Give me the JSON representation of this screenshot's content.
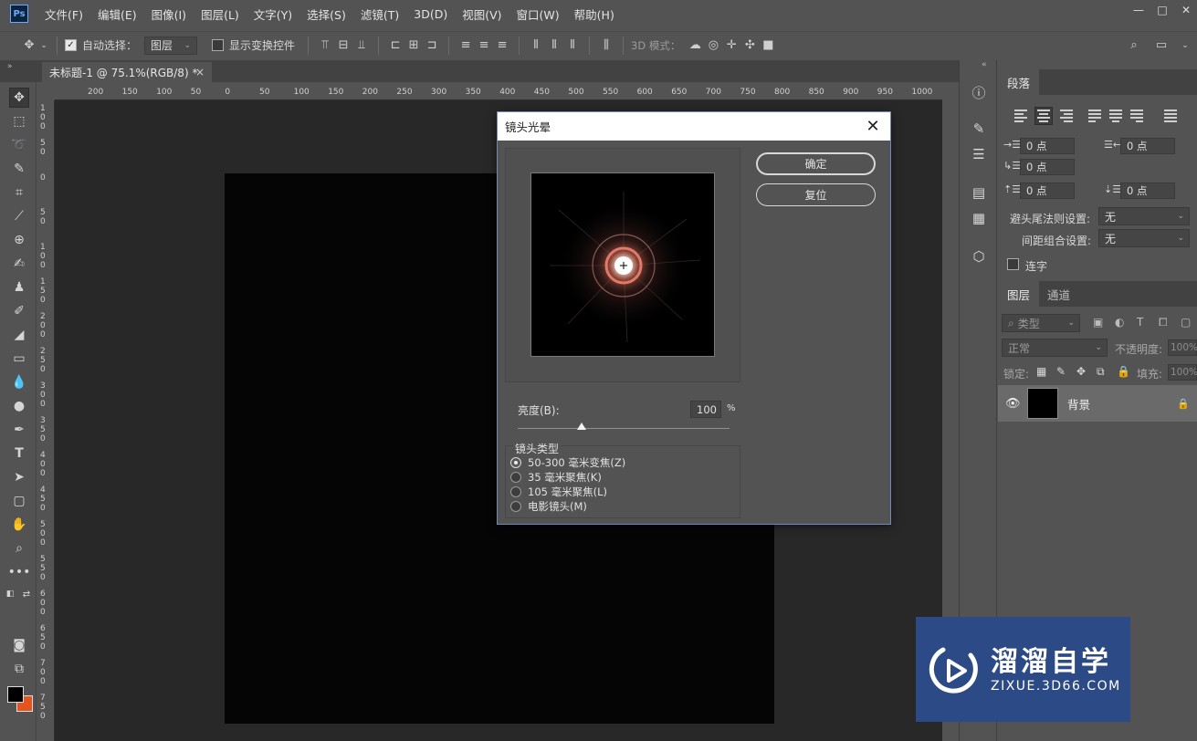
{
  "app": {
    "logo": "Ps"
  },
  "menu": [
    "文件(F)",
    "编辑(E)",
    "图像(I)",
    "图层(L)",
    "文字(Y)",
    "选择(S)",
    "滤镜(T)",
    "3D(D)",
    "视图(V)",
    "窗口(W)",
    "帮助(H)"
  ],
  "window_controls": {
    "minimize": "—",
    "maximize": "□",
    "close": "✕"
  },
  "options": {
    "auto_select_label": "自动选择：",
    "auto_select_checked": true,
    "auto_select_target": "图层",
    "show_transform_label": "显示变换控件",
    "mode_3d_label": "3D 模式："
  },
  "document_tab": {
    "title": "未标题-1 @ 75.1%(RGB/8) *",
    "close": "×"
  },
  "ruler_top": [
    "200",
    "150",
    "100",
    "50",
    "0",
    "50",
    "100",
    "150",
    "200",
    "250",
    "300",
    "350",
    "400",
    "450",
    "500",
    "550",
    "600",
    "650",
    "700",
    "750",
    "800",
    "850",
    "900",
    "950",
    "1000"
  ],
  "ruler_left": [
    "100",
    "50",
    "0",
    "50",
    "100",
    "150",
    "200",
    "250",
    "300",
    "350",
    "400",
    "450",
    "500",
    "550",
    "600",
    "650",
    "700",
    "750"
  ],
  "colors": {
    "foreground": "#000000",
    "background": "#e4541e",
    "accent": "#6f88b5",
    "watermark_bg": "#2c4a86"
  },
  "paragraph_panel": {
    "tab": "段落",
    "indent_left": "0 点",
    "indent_right": "0 点",
    "indent_first": "0 点",
    "space_before": "0 点",
    "space_after": "0 点",
    "kinsoku_label": "避头尾法则设置:",
    "kinsoku_value": "无",
    "mojikumi_label": "间距组合设置:",
    "mojikumi_value": "无",
    "hyphenate_label": "连字"
  },
  "layers_panel": {
    "tab_layers": "图层",
    "tab_channels": "通道",
    "filter_kind": "类型",
    "blend_mode": "正常",
    "opacity_label": "不透明度:",
    "opacity_value": "100%",
    "lock_label": "锁定:",
    "fill_label": "填充:",
    "fill_value": "100%",
    "layers": [
      {
        "name": "背景",
        "visible": true,
        "locked": true
      }
    ]
  },
  "dialog": {
    "title": "镜头光晕",
    "ok": "确定",
    "reset": "复位",
    "brightness_label": "亮度(B):",
    "brightness_value": "100",
    "brightness_unit": "%",
    "brightness_fraction": 0.3,
    "lens_type_label": "镜头类型",
    "lens_types": [
      "50-300 毫米变焦(Z)",
      "35 毫米聚焦(K)",
      "105 毫米聚焦(L)",
      "电影镜头(M)"
    ],
    "selected_lens": 0
  },
  "watermark": {
    "name": "溜溜自学",
    "url": "ZIXUE.3D66.COM"
  }
}
